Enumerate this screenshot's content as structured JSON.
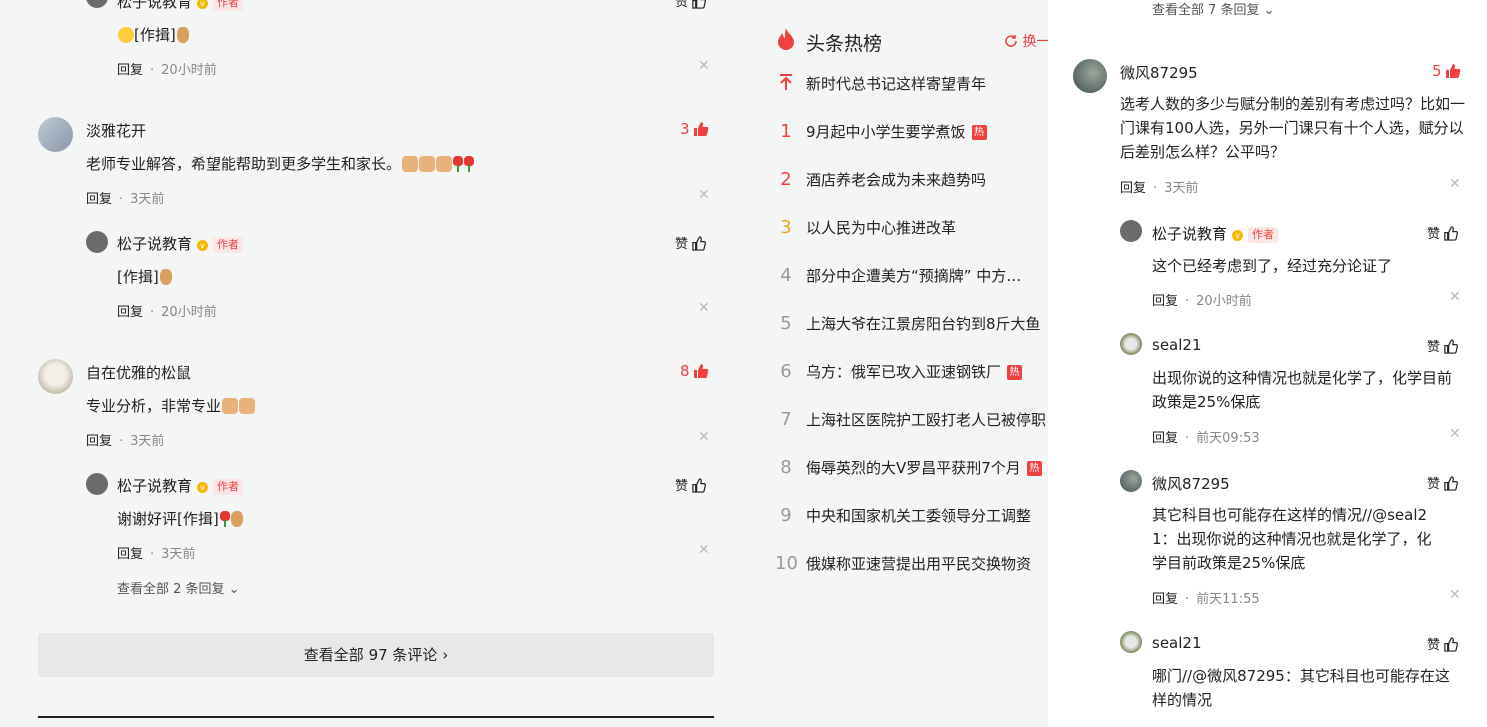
{
  "left_comments": {
    "c0": {
      "author": "松子说教育",
      "badge": "作者",
      "like_label": "赞",
      "text": "[作揖]",
      "reply_label": "回复",
      "time": "20小时前"
    },
    "c1": {
      "author": "淡雅花开",
      "likes": "3",
      "text": "老师专业解答，希望能帮助到更多学生和家长。",
      "reply_label": "回复",
      "time": "3天前",
      "reply": {
        "author": "松子说教育",
        "badge": "作者",
        "like_label": "赞",
        "text": "[作揖]",
        "reply_label": "回复",
        "time": "20小时前"
      }
    },
    "c2": {
      "author": "自在优雅的松鼠",
      "likes": "8",
      "text": "专业分析，非常专业",
      "reply_label": "回复",
      "time": "3天前",
      "reply": {
        "author": "松子说教育",
        "badge": "作者",
        "like_label": "赞",
        "text": "谢谢好评[作揖]",
        "reply_label": "回复",
        "time": "3天前"
      },
      "view_all_replies": "查看全部 2 条回复"
    },
    "view_all_comments": "查看全部 97 条评论"
  },
  "hot_list": {
    "title": "头条热榜",
    "change_label": "换一",
    "hot_tag": "热",
    "items": [
      {
        "rank": "",
        "title": "新时代总书记这样寄望青年"
      },
      {
        "rank": "1",
        "title": "9月起中小学生要学煮饭"
      },
      {
        "rank": "2",
        "title": "酒店养老会成为未来趋势吗"
      },
      {
        "rank": "3",
        "title": "以人民为中心推进改革"
      },
      {
        "rank": "4",
        "title": "部分中企遭美方“预摘牌” 中方…"
      },
      {
        "rank": "5",
        "title": "上海大爷在江景房阳台钓到8斤大鱼"
      },
      {
        "rank": "6",
        "title": "乌方：俄军已攻入亚速钢铁厂"
      },
      {
        "rank": "7",
        "title": "上海社区医院护工殴打老人已被停职"
      },
      {
        "rank": "8",
        "title": "侮辱英烈的大V罗昌平获刑7个月"
      },
      {
        "rank": "9",
        "title": "中央和国家机关工委领导分工调整"
      },
      {
        "rank": "10",
        "title": "俄媒称亚速营提出用平民交换物资"
      }
    ]
  },
  "drawer": {
    "top_view_all": "查看全部 7 条回复",
    "main": {
      "author": "微风87295",
      "likes": "5",
      "text": "选考人数的多少与赋分制的差别有考虑过吗？比如一门课有100人选，另外一门课只有十个人选，赋分以后差别怎么样？公平吗？",
      "reply_label": "回复",
      "time": "3天前"
    },
    "replies": [
      {
        "author": "松子说教育",
        "badge": "作者",
        "like_label": "赞",
        "text": "这个已经考虑到了，经过充分论证了",
        "reply_label": "回复",
        "time": "20小时前"
      },
      {
        "author": "seal21",
        "like_label": "赞",
        "text": "出现你说的这种情况也就是化学了，化学目前政策是25%保底",
        "reply_label": "回复",
        "time": "前天09:53"
      },
      {
        "author": "微风87295",
        "like_label": "赞",
        "text": "其它科目也可能存在这样的情况//@seal21：出现你说的这种情况也就是化学了，化学目前政策是25%保底",
        "reply_label": "回复",
        "time": "前天11:55"
      },
      {
        "author": "seal21",
        "like_label": "赞",
        "text": "哪门//@微风87295：其它科目也可能存在这样的情况"
      }
    ]
  },
  "colors": {
    "accent": "#f04142",
    "gold": "#f0a020",
    "page_bg": "#f4f5f5"
  }
}
